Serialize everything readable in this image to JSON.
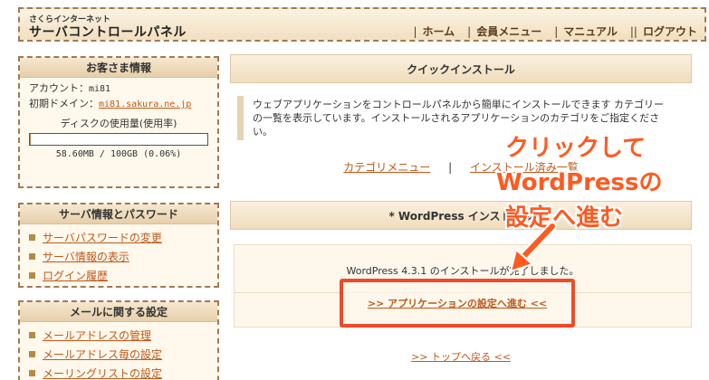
{
  "header": {
    "logo_sub": "さくらインターネット",
    "logo_main": "サーバコントロールパネル",
    "nav": [
      {
        "label": "ホーム"
      },
      {
        "label": "会員メニュー"
      },
      {
        "label": "マニュアル"
      },
      {
        "label": "ログアウト"
      }
    ]
  },
  "customer": {
    "title": "お客さま情報",
    "account_label": "アカウント：",
    "account_value": "mi81",
    "domain_label": "初期ドメイン：",
    "domain_value": "mi81.sakura.ne.jp",
    "disk_label": "ディスクの使用量(使用率)",
    "disk_value": "58.60MB / 100GB (0.06%)",
    "disk_usage_percent": 0.06
  },
  "server_info": {
    "title": "サーバ情報とパスワード",
    "items": [
      {
        "label": "サーバパスワードの変更"
      },
      {
        "label": "サーバ情報の表示"
      },
      {
        "label": "ログイン履歴"
      }
    ]
  },
  "mail": {
    "title": "メールに関する設定",
    "items": [
      {
        "label": "メールアドレスの管理"
      },
      {
        "label": "メールアドレス毎の設定"
      },
      {
        "label": "メーリングリストの設定"
      }
    ]
  },
  "main": {
    "quick_install_title": "クイックインストール",
    "description": "ウェブアプリケーションをコントロールパネルから簡単にインストールできます カテゴリーの一覧を表示しています。インストールされるアプリケーションのカテゴリをご指定ください。",
    "category_link": "カテゴリメニュー",
    "link_sep": "|",
    "installed_link": "インストール済み一覧",
    "wp_install_title": "* WordPress インストール",
    "result_message": "WordPress 4.3.1 のインストールが完了しました。",
    "app_settings_link": ">> アプリケーションの設定へ進む <<",
    "top_link": ">> トップへ戻る <<"
  },
  "annotation": {
    "line1": "クリックして",
    "line2": "WordPressの",
    "line3": "設定へ進む",
    "color": "#ff5a1f"
  }
}
